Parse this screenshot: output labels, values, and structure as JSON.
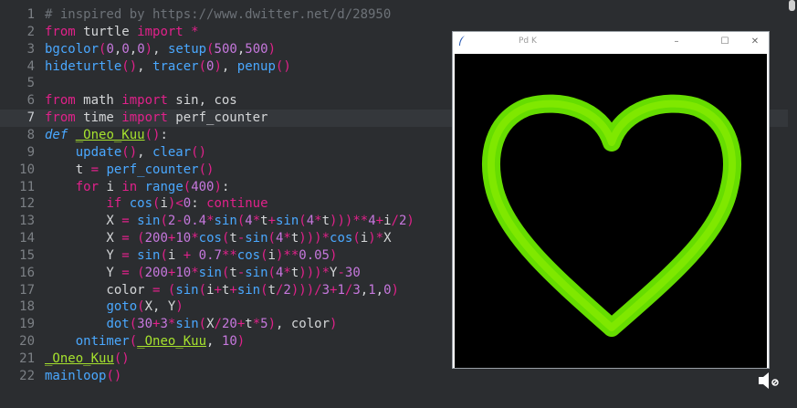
{
  "editor": {
    "current_line": 7,
    "lines": [
      {
        "n": "1",
        "segs": [
          {
            "c": "tk-com",
            "t": "# inspired by https://www.dwitter.net/d/28950"
          }
        ]
      },
      {
        "n": "2",
        "segs": [
          {
            "c": "tk-kw",
            "t": "from"
          },
          {
            "c": "",
            "t": " turtle "
          },
          {
            "c": "tk-kw",
            "t": "import"
          },
          {
            "c": "",
            "t": " "
          },
          {
            "c": "tk-op",
            "t": "*"
          }
        ]
      },
      {
        "n": "3",
        "segs": [
          {
            "c": "tk-fn",
            "t": "bgcolor"
          },
          {
            "c": "tk-paren",
            "t": "("
          },
          {
            "c": "tk-num",
            "t": "0"
          },
          {
            "c": "",
            "t": ","
          },
          {
            "c": "tk-num",
            "t": "0"
          },
          {
            "c": "",
            "t": ","
          },
          {
            "c": "tk-num",
            "t": "0"
          },
          {
            "c": "tk-paren",
            "t": ")"
          },
          {
            "c": "",
            "t": ", "
          },
          {
            "c": "tk-fn",
            "t": "setup"
          },
          {
            "c": "tk-paren",
            "t": "("
          },
          {
            "c": "tk-num",
            "t": "500"
          },
          {
            "c": "",
            "t": ","
          },
          {
            "c": "tk-num",
            "t": "500"
          },
          {
            "c": "tk-paren",
            "t": ")"
          }
        ]
      },
      {
        "n": "4",
        "segs": [
          {
            "c": "tk-fn",
            "t": "hideturtle"
          },
          {
            "c": "tk-paren",
            "t": "()"
          },
          {
            "c": "",
            "t": ", "
          },
          {
            "c": "tk-fn",
            "t": "tracer"
          },
          {
            "c": "tk-paren",
            "t": "("
          },
          {
            "c": "tk-num",
            "t": "0"
          },
          {
            "c": "tk-paren",
            "t": ")"
          },
          {
            "c": "",
            "t": ", "
          },
          {
            "c": "tk-fn",
            "t": "penup"
          },
          {
            "c": "tk-paren",
            "t": "()"
          }
        ]
      },
      {
        "n": "5",
        "segs": []
      },
      {
        "n": "6",
        "segs": [
          {
            "c": "tk-kw",
            "t": "from"
          },
          {
            "c": "",
            "t": " math "
          },
          {
            "c": "tk-kw",
            "t": "import"
          },
          {
            "c": "",
            "t": " sin, cos"
          }
        ]
      },
      {
        "n": "7",
        "segs": [
          {
            "c": "tk-kw",
            "t": "from"
          },
          {
            "c": "",
            "t": " time "
          },
          {
            "c": "tk-kw",
            "t": "import"
          },
          {
            "c": "",
            "t": " perf_counter"
          }
        ]
      },
      {
        "n": "8",
        "segs": [
          {
            "c": "tk-def",
            "t": "def"
          },
          {
            "c": "",
            "t": " "
          },
          {
            "c": "tk-name",
            "t": "_Oneo_Kuu"
          },
          {
            "c": "tk-paren",
            "t": "()"
          },
          {
            "c": "",
            "t": ":"
          }
        ]
      },
      {
        "n": "9",
        "segs": [
          {
            "c": "",
            "t": "    "
          },
          {
            "c": "tk-fn",
            "t": "update"
          },
          {
            "c": "tk-paren",
            "t": "()"
          },
          {
            "c": "",
            "t": ", "
          },
          {
            "c": "tk-fn",
            "t": "clear"
          },
          {
            "c": "tk-paren",
            "t": "()"
          }
        ]
      },
      {
        "n": "10",
        "segs": [
          {
            "c": "",
            "t": "    t "
          },
          {
            "c": "tk-op",
            "t": "="
          },
          {
            "c": "",
            "t": " "
          },
          {
            "c": "tk-fn",
            "t": "perf_counter"
          },
          {
            "c": "tk-paren",
            "t": "()"
          }
        ]
      },
      {
        "n": "11",
        "segs": [
          {
            "c": "",
            "t": "    "
          },
          {
            "c": "tk-kw",
            "t": "for"
          },
          {
            "c": "",
            "t": " i "
          },
          {
            "c": "tk-kw",
            "t": "in"
          },
          {
            "c": "",
            "t": " "
          },
          {
            "c": "tk-fn",
            "t": "range"
          },
          {
            "c": "tk-paren",
            "t": "("
          },
          {
            "c": "tk-num",
            "t": "400"
          },
          {
            "c": "tk-paren",
            "t": ")"
          },
          {
            "c": "",
            "t": ":"
          }
        ]
      },
      {
        "n": "12",
        "segs": [
          {
            "c": "",
            "t": "        "
          },
          {
            "c": "tk-kw",
            "t": "if"
          },
          {
            "c": "",
            "t": " "
          },
          {
            "c": "tk-fn",
            "t": "cos"
          },
          {
            "c": "tk-paren",
            "t": "("
          },
          {
            "c": "",
            "t": "i"
          },
          {
            "c": "tk-paren",
            "t": ")"
          },
          {
            "c": "tk-op",
            "t": "<"
          },
          {
            "c": "tk-num",
            "t": "0"
          },
          {
            "c": "",
            "t": ": "
          },
          {
            "c": "tk-kw",
            "t": "continue"
          }
        ]
      },
      {
        "n": "13",
        "segs": [
          {
            "c": "",
            "t": "        X "
          },
          {
            "c": "tk-op",
            "t": "="
          },
          {
            "c": "",
            "t": " "
          },
          {
            "c": "tk-fn",
            "t": "sin"
          },
          {
            "c": "tk-paren",
            "t": "("
          },
          {
            "c": "tk-num",
            "t": "2"
          },
          {
            "c": "tk-op",
            "t": "-"
          },
          {
            "c": "tk-num",
            "t": "0.4"
          },
          {
            "c": "tk-op",
            "t": "*"
          },
          {
            "c": "tk-fn",
            "t": "sin"
          },
          {
            "c": "tk-paren",
            "t": "("
          },
          {
            "c": "tk-num",
            "t": "4"
          },
          {
            "c": "tk-op",
            "t": "*"
          },
          {
            "c": "",
            "t": "t"
          },
          {
            "c": "tk-op",
            "t": "+"
          },
          {
            "c": "tk-fn",
            "t": "sin"
          },
          {
            "c": "tk-paren",
            "t": "("
          },
          {
            "c": "tk-num",
            "t": "4"
          },
          {
            "c": "tk-op",
            "t": "*"
          },
          {
            "c": "",
            "t": "t"
          },
          {
            "c": "tk-paren",
            "t": ")))"
          },
          {
            "c": "tk-op",
            "t": "**"
          },
          {
            "c": "tk-num",
            "t": "4"
          },
          {
            "c": "tk-op",
            "t": "+"
          },
          {
            "c": "",
            "t": "i"
          },
          {
            "c": "tk-op",
            "t": "/"
          },
          {
            "c": "tk-num",
            "t": "2"
          },
          {
            "c": "tk-paren",
            "t": ")"
          }
        ]
      },
      {
        "n": "14",
        "segs": [
          {
            "c": "",
            "t": "        X "
          },
          {
            "c": "tk-op",
            "t": "="
          },
          {
            "c": "",
            "t": " "
          },
          {
            "c": "tk-paren",
            "t": "("
          },
          {
            "c": "tk-num",
            "t": "200"
          },
          {
            "c": "tk-op",
            "t": "+"
          },
          {
            "c": "tk-num",
            "t": "10"
          },
          {
            "c": "tk-op",
            "t": "*"
          },
          {
            "c": "tk-fn",
            "t": "cos"
          },
          {
            "c": "tk-paren",
            "t": "("
          },
          {
            "c": "",
            "t": "t"
          },
          {
            "c": "tk-op",
            "t": "-"
          },
          {
            "c": "tk-fn",
            "t": "sin"
          },
          {
            "c": "tk-paren",
            "t": "("
          },
          {
            "c": "tk-num",
            "t": "4"
          },
          {
            "c": "tk-op",
            "t": "*"
          },
          {
            "c": "",
            "t": "t"
          },
          {
            "c": "tk-paren",
            "t": ")))"
          },
          {
            "c": "tk-op",
            "t": "*"
          },
          {
            "c": "tk-fn",
            "t": "cos"
          },
          {
            "c": "tk-paren",
            "t": "("
          },
          {
            "c": "",
            "t": "i"
          },
          {
            "c": "tk-paren",
            "t": ")"
          },
          {
            "c": "tk-op",
            "t": "*"
          },
          {
            "c": "",
            "t": "X"
          }
        ]
      },
      {
        "n": "15",
        "segs": [
          {
            "c": "",
            "t": "        Y "
          },
          {
            "c": "tk-op",
            "t": "="
          },
          {
            "c": "",
            "t": " "
          },
          {
            "c": "tk-fn",
            "t": "sin"
          },
          {
            "c": "tk-paren",
            "t": "("
          },
          {
            "c": "",
            "t": "i "
          },
          {
            "c": "tk-op",
            "t": "+"
          },
          {
            "c": "",
            "t": " "
          },
          {
            "c": "tk-num",
            "t": "0.7"
          },
          {
            "c": "tk-op",
            "t": "**"
          },
          {
            "c": "tk-fn",
            "t": "cos"
          },
          {
            "c": "tk-paren",
            "t": "("
          },
          {
            "c": "",
            "t": "i"
          },
          {
            "c": "tk-paren",
            "t": ")"
          },
          {
            "c": "tk-op",
            "t": "**"
          },
          {
            "c": "tk-num",
            "t": "0.05"
          },
          {
            "c": "tk-paren",
            "t": ")"
          }
        ]
      },
      {
        "n": "16",
        "segs": [
          {
            "c": "",
            "t": "        Y "
          },
          {
            "c": "tk-op",
            "t": "="
          },
          {
            "c": "",
            "t": " "
          },
          {
            "c": "tk-paren",
            "t": "("
          },
          {
            "c": "tk-num",
            "t": "200"
          },
          {
            "c": "tk-op",
            "t": "+"
          },
          {
            "c": "tk-num",
            "t": "10"
          },
          {
            "c": "tk-op",
            "t": "*"
          },
          {
            "c": "tk-fn",
            "t": "sin"
          },
          {
            "c": "tk-paren",
            "t": "("
          },
          {
            "c": "",
            "t": "t"
          },
          {
            "c": "tk-op",
            "t": "-"
          },
          {
            "c": "tk-fn",
            "t": "sin"
          },
          {
            "c": "tk-paren",
            "t": "("
          },
          {
            "c": "tk-num",
            "t": "4"
          },
          {
            "c": "tk-op",
            "t": "*"
          },
          {
            "c": "",
            "t": "t"
          },
          {
            "c": "tk-paren",
            "t": ")))"
          },
          {
            "c": "tk-op",
            "t": "*"
          },
          {
            "c": "",
            "t": "Y"
          },
          {
            "c": "tk-op",
            "t": "-"
          },
          {
            "c": "tk-num",
            "t": "30"
          }
        ]
      },
      {
        "n": "17",
        "segs": [
          {
            "c": "",
            "t": "        color "
          },
          {
            "c": "tk-op",
            "t": "="
          },
          {
            "c": "",
            "t": " "
          },
          {
            "c": "tk-paren",
            "t": "("
          },
          {
            "c": "tk-fn",
            "t": "sin"
          },
          {
            "c": "tk-paren",
            "t": "("
          },
          {
            "c": "",
            "t": "i"
          },
          {
            "c": "tk-op",
            "t": "+"
          },
          {
            "c": "",
            "t": "t"
          },
          {
            "c": "tk-op",
            "t": "+"
          },
          {
            "c": "tk-fn",
            "t": "sin"
          },
          {
            "c": "tk-paren",
            "t": "("
          },
          {
            "c": "",
            "t": "t"
          },
          {
            "c": "tk-op",
            "t": "/"
          },
          {
            "c": "tk-num",
            "t": "2"
          },
          {
            "c": "tk-paren",
            "t": "))"
          },
          {
            "c": "tk-op",
            "t": ")/"
          },
          {
            "c": "tk-num",
            "t": "3"
          },
          {
            "c": "tk-op",
            "t": "+"
          },
          {
            "c": "tk-num",
            "t": "1"
          },
          {
            "c": "tk-op",
            "t": "/"
          },
          {
            "c": "tk-num",
            "t": "3"
          },
          {
            "c": "",
            "t": ","
          },
          {
            "c": "tk-num",
            "t": "1"
          },
          {
            "c": "",
            "t": ","
          },
          {
            "c": "tk-num",
            "t": "0"
          },
          {
            "c": "tk-paren",
            "t": ")"
          }
        ]
      },
      {
        "n": "18",
        "segs": [
          {
            "c": "",
            "t": "        "
          },
          {
            "c": "tk-fn",
            "t": "goto"
          },
          {
            "c": "tk-paren",
            "t": "("
          },
          {
            "c": "",
            "t": "X, Y"
          },
          {
            "c": "tk-paren",
            "t": ")"
          }
        ]
      },
      {
        "n": "19",
        "segs": [
          {
            "c": "",
            "t": "        "
          },
          {
            "c": "tk-fn",
            "t": "dot"
          },
          {
            "c": "tk-paren",
            "t": "("
          },
          {
            "c": "tk-num",
            "t": "30"
          },
          {
            "c": "tk-op",
            "t": "+"
          },
          {
            "c": "tk-num",
            "t": "3"
          },
          {
            "c": "tk-op",
            "t": "*"
          },
          {
            "c": "tk-fn",
            "t": "sin"
          },
          {
            "c": "tk-paren",
            "t": "("
          },
          {
            "c": "",
            "t": "X"
          },
          {
            "c": "tk-op",
            "t": "/"
          },
          {
            "c": "tk-num",
            "t": "20"
          },
          {
            "c": "tk-op",
            "t": "+"
          },
          {
            "c": "",
            "t": "t"
          },
          {
            "c": "tk-op",
            "t": "*"
          },
          {
            "c": "tk-num",
            "t": "5"
          },
          {
            "c": "tk-paren",
            "t": ")"
          },
          {
            "c": "",
            "t": ", color"
          },
          {
            "c": "tk-paren",
            "t": ")"
          }
        ]
      },
      {
        "n": "20",
        "segs": [
          {
            "c": "",
            "t": "    "
          },
          {
            "c": "tk-fn",
            "t": "ontimer"
          },
          {
            "c": "tk-paren",
            "t": "("
          },
          {
            "c": "tk-name",
            "t": "_Oneo_Kuu"
          },
          {
            "c": "",
            "t": ", "
          },
          {
            "c": "tk-num",
            "t": "10"
          },
          {
            "c": "tk-paren",
            "t": ")"
          }
        ]
      },
      {
        "n": "21",
        "segs": [
          {
            "c": "tk-name",
            "t": "_Oneo_Kuu"
          },
          {
            "c": "tk-paren",
            "t": "()"
          }
        ]
      },
      {
        "n": "22",
        "segs": [
          {
            "c": "tk-fn",
            "t": "mainloop"
          },
          {
            "c": "tk-paren",
            "t": "()"
          }
        ]
      }
    ]
  },
  "turtle_window": {
    "title": "Pd K",
    "app_icon": "feather-icon",
    "minimize": "–",
    "maximize": "☐",
    "close": "✕",
    "canvas_bg": "#000000",
    "heart_color": "#66dd00"
  },
  "taskbar": {
    "volume_icon": "speaker-icon"
  }
}
